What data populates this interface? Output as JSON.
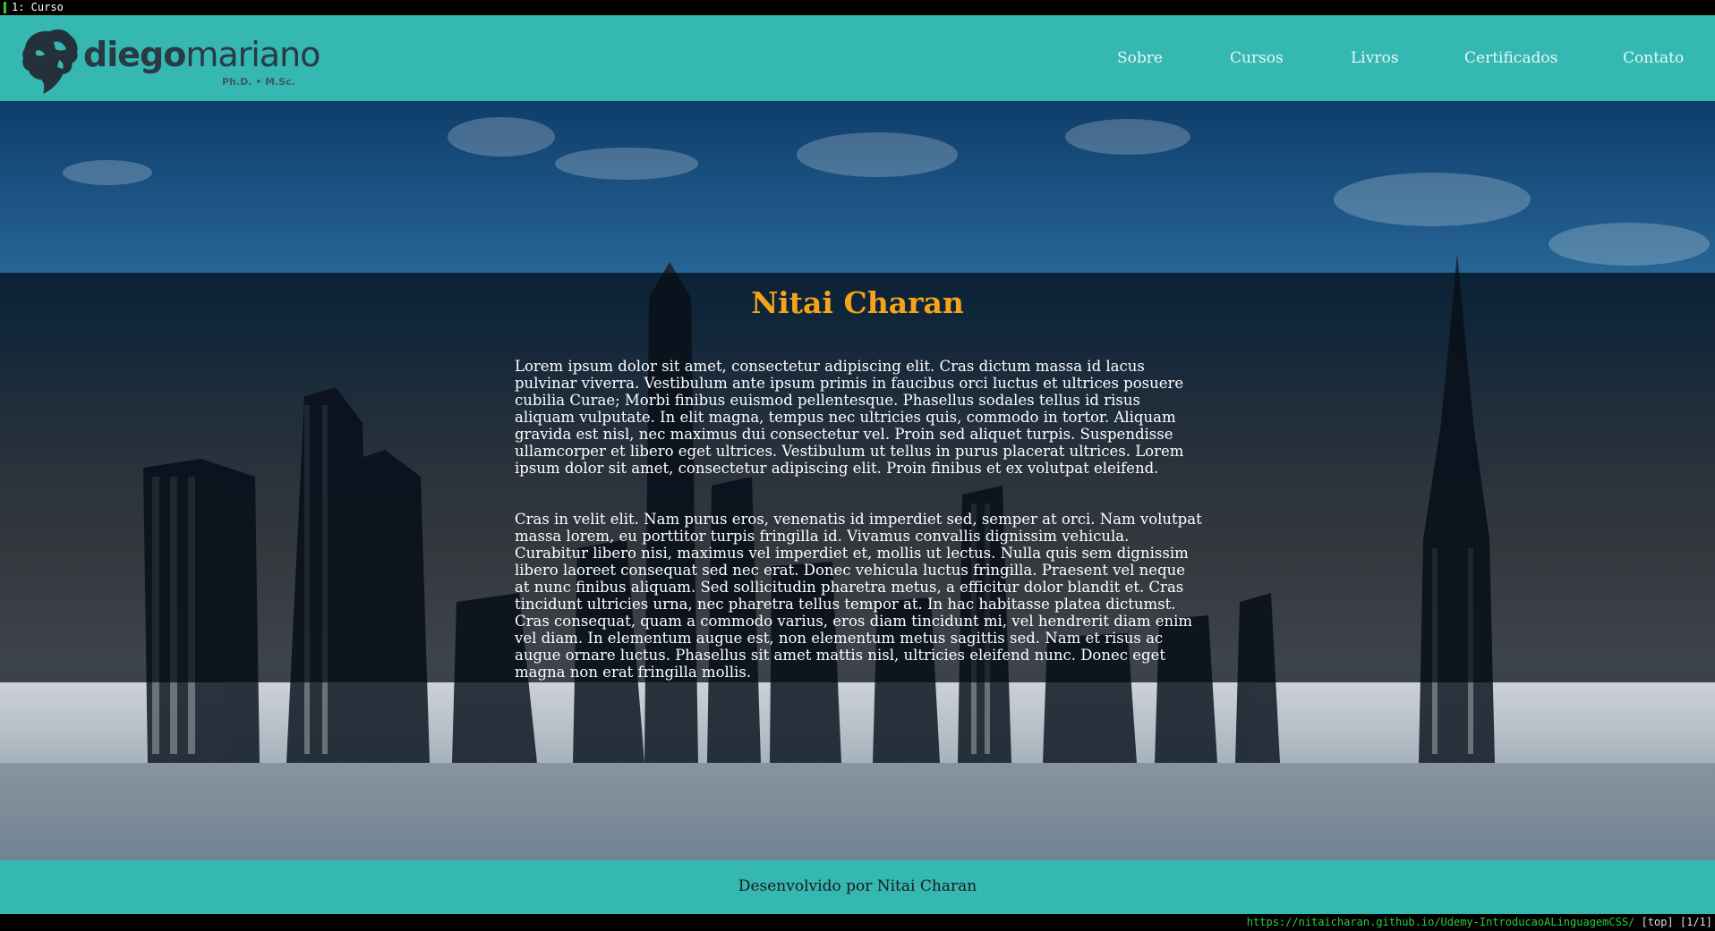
{
  "browser": {
    "tab_title": "1: Curso",
    "status_url": "https://nitaicharan.github.io/Udemy-IntroducaoALinguagemCSS/",
    "status_position": "[top] [1/1]"
  },
  "header": {
    "logo_bold": "diego",
    "logo_light": "mariano",
    "logo_subtitle": "Ph.D. • M.Sc.",
    "nav": [
      "Sobre",
      "Cursos",
      "Livros",
      "Certificados",
      "Contato"
    ]
  },
  "main": {
    "title": "Nitai Charan",
    "paragraphs": [
      "Lorem ipsum dolor sit amet, consectetur adipiscing elit. Cras dictum massa id lacus pulvinar viverra. Vestibulum ante ipsum primis in faucibus orci luctus et ultrices posuere cubilia Curae; Morbi finibus euismod pellentesque. Phasellus sodales tellus id risus aliquam vulputate. In elit magna, tempus nec ultricies quis, commodo in tortor. Aliquam gravida est nisl, nec maximus dui consectetur vel. Proin sed aliquet turpis. Suspendisse ullamcorper et libero eget ultrices. Vestibulum ut tellus in purus placerat ultrices. Lorem ipsum dolor sit amet, consectetur adipiscing elit. Proin finibus et ex volutpat eleifend.",
      "Cras in velit elit. Nam purus eros, venenatis id imperdiet sed, semper at orci. Nam volutpat massa lorem, eu porttitor turpis fringilla id. Vivamus convallis dignissim vehicula. Curabitur libero nisi, maximus vel imperdiet et, mollis ut lectus. Nulla quis sem dignissim libero laoreet consequat sed nec erat. Donec vehicula luctus fringilla. Praesent vel neque at nunc finibus aliquam. Sed sollicitudin pharetra metus, a efficitur dolor blandit et. Cras tincidunt ultricies urna, nec pharetra tellus tempor at. In hac habitasse platea dictumst. Cras consequat, quam a commodo varius, eros diam tincidunt mi, vel hendrerit diam enim vel diam. In elementum augue est, non elementum metus sagittis sed. Nam et risus ac augue ornare luctus. Phasellus sit amet mattis nisl, ultricies eleifend nunc. Donec eget magna non erat fringilla mollis."
    ]
  },
  "footer": {
    "text": "Desenvolvido por Nitai Charan"
  },
  "colors": {
    "header_bg": "#35b8b1",
    "title": "#f5a31a",
    "status_url": "#2ecc40"
  },
  "icons": {
    "logo": "lion-head-icon"
  }
}
